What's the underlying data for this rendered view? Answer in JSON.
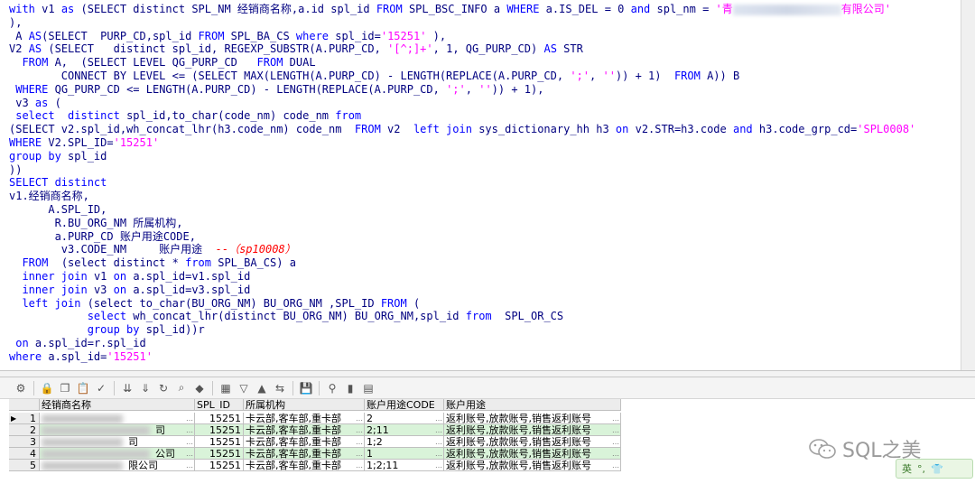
{
  "editor": {
    "lines": [
      [
        [
          "kw",
          "with "
        ],
        [
          "pl",
          "v1 "
        ],
        [
          "kw",
          "as "
        ],
        [
          "pl",
          "(SELECT distinct SPL_NM 经销商名称,a.id spl_id "
        ],
        [
          "kw",
          "FROM "
        ],
        [
          "pl",
          "SPL_BSC_INFO a "
        ],
        [
          "kw",
          "WHERE "
        ],
        [
          "pl",
          "a.IS_DEL = 0 "
        ],
        [
          "kw",
          "and "
        ],
        [
          "pl",
          "spl_nm = "
        ],
        [
          "str",
          "'青"
        ],
        [
          "blur",
          ""
        ],
        [
          "str",
          "有限公司'"
        ]
      ],
      [
        [
          "pl",
          "),"
        ]
      ],
      [
        [
          "pl",
          " A "
        ],
        [
          "kw",
          "AS"
        ],
        [
          "pl",
          "(SELECT  PURP_CD,spl_id "
        ],
        [
          "kw",
          "FROM "
        ],
        [
          "pl",
          "SPL_BA_CS "
        ],
        [
          "kw",
          "where "
        ],
        [
          "pl",
          "spl_id="
        ],
        [
          "str",
          "'15251'"
        ],
        [
          "pl",
          " ),"
        ]
      ],
      [
        [
          "pl",
          "V2 "
        ],
        [
          "kw",
          "AS "
        ],
        [
          "pl",
          "(SELECT   distinct spl_id, REGEXP_SUBSTR(A.PURP_CD, "
        ],
        [
          "str",
          "'[^;]+'"
        ],
        [
          "pl",
          ", 1, QG_PURP_CD) "
        ],
        [
          "kw",
          "AS "
        ],
        [
          "pl",
          "STR"
        ]
      ],
      [
        [
          "pl",
          "  "
        ],
        [
          "kw",
          "FROM "
        ],
        [
          "pl",
          "A,  (SELECT LEVEL QG_PURP_CD   "
        ],
        [
          "kw",
          "FROM "
        ],
        [
          "pl",
          "DUAL"
        ]
      ],
      [
        [
          "pl",
          "        CONNECT BY LEVEL <= (SELECT MAX(LENGTH(A.PURP_CD) - LENGTH(REPLACE(A.PURP_CD, "
        ],
        [
          "str",
          "';'"
        ],
        [
          "pl",
          ", "
        ],
        [
          "str",
          "''"
        ],
        [
          "pl",
          ")) + 1)  "
        ],
        [
          "kw",
          "FROM "
        ],
        [
          "pl",
          "A)) B"
        ]
      ],
      [
        [
          "pl",
          " "
        ],
        [
          "kw",
          "WHERE "
        ],
        [
          "pl",
          "QG_PURP_CD <= LENGTH(A.PURP_CD) - LENGTH(REPLACE(A.PURP_CD, "
        ],
        [
          "str",
          "';'"
        ],
        [
          "pl",
          ", "
        ],
        [
          "str",
          "''"
        ],
        [
          "pl",
          ")) + 1),"
        ]
      ],
      [
        [
          "pl",
          " v3 "
        ],
        [
          "kw",
          "as "
        ],
        [
          "pl",
          "("
        ]
      ],
      [
        [
          "pl",
          " "
        ],
        [
          "kw",
          "select  distinct "
        ],
        [
          "pl",
          "spl_id,to_char(code_nm) code_nm "
        ],
        [
          "kw",
          "from"
        ]
      ],
      [
        [
          "pl",
          "(SELECT v2.spl_id,wh_concat_lhr(h3.code_nm) code_nm  "
        ],
        [
          "kw",
          "FROM "
        ],
        [
          "pl",
          "v2  "
        ],
        [
          "kw",
          "left join "
        ],
        [
          "pl",
          "sys_dictionary_hh h3 "
        ],
        [
          "kw",
          "on "
        ],
        [
          "pl",
          "v2.STR=h3.code "
        ],
        [
          "kw",
          "and "
        ],
        [
          "pl",
          "h3.code_grp_cd="
        ],
        [
          "str",
          "'SPL0008'"
        ]
      ],
      [
        [
          "kw",
          "WHERE "
        ],
        [
          "pl",
          "V2.SPL_ID="
        ],
        [
          "str",
          "'15251'"
        ]
      ],
      [
        [
          "kw",
          "group by "
        ],
        [
          "pl",
          "spl_id"
        ]
      ],
      [
        [
          "pl",
          "))"
        ]
      ],
      [
        [
          "kw",
          "SELECT distinct"
        ]
      ],
      [
        [
          "pl",
          "v1.经销商名称,"
        ]
      ],
      [
        [
          "pl",
          "      A.SPL_ID,"
        ]
      ],
      [
        [
          "pl",
          "       R.BU_ORG_NM 所属机构,"
        ]
      ],
      [
        [
          "pl",
          "       a.PURP_CD 账户用途CODE,"
        ]
      ],
      [
        [
          "pl",
          "        v3.CODE_NM     账户用途  "
        ],
        [
          "cmt",
          "--（sp10008）"
        ]
      ],
      [
        [
          "pl",
          "  "
        ],
        [
          "kw",
          "FROM  "
        ],
        [
          "pl",
          "(select distinct * "
        ],
        [
          "kw",
          "from "
        ],
        [
          "pl",
          "SPL_BA_CS) a"
        ]
      ],
      [
        [
          "pl",
          "  "
        ],
        [
          "kw",
          "inner join "
        ],
        [
          "pl",
          "v1 "
        ],
        [
          "kw",
          "on "
        ],
        [
          "pl",
          "a.spl_id=v1.spl_id"
        ]
      ],
      [
        [
          "pl",
          "  "
        ],
        [
          "kw",
          "inner join "
        ],
        [
          "pl",
          "v3 "
        ],
        [
          "kw",
          "on "
        ],
        [
          "pl",
          "a.spl_id=v3.spl_id"
        ]
      ],
      [
        [
          "pl",
          "  "
        ],
        [
          "kw",
          "left join "
        ],
        [
          "pl",
          "(select to_char(BU_ORG_NM) BU_ORG_NM ,SPL_ID "
        ],
        [
          "kw",
          "FROM "
        ],
        [
          "pl",
          "("
        ]
      ],
      [
        [
          "pl",
          "            "
        ],
        [
          "kw",
          "select "
        ],
        [
          "pl",
          "wh_concat_lhr(distinct BU_ORG_NM) BU_ORG_NM,spl_id "
        ],
        [
          "kw",
          "from  "
        ],
        [
          "pl",
          "SPL_OR_CS"
        ]
      ],
      [
        [
          "pl",
          "            "
        ],
        [
          "kw",
          "group by "
        ],
        [
          "pl",
          "spl_id))r"
        ]
      ],
      [
        [
          "pl",
          " "
        ],
        [
          "kw",
          "on "
        ],
        [
          "pl",
          "a.spl_id=r.spl_id"
        ]
      ],
      [
        [
          "kw",
          "where "
        ],
        [
          "pl",
          "a.spl_id="
        ],
        [
          "str",
          "'15251'"
        ]
      ]
    ]
  },
  "toolbar": {
    "icons": [
      "grid-options-icon",
      "lock-icon",
      "copy-icon",
      "paste-icon",
      "check-icon",
      "move-down-icon",
      "move-last-icon",
      "refresh-icon",
      "find-icon",
      "clear-icon",
      "table-view-icon",
      "filter-icon",
      "sort-up-icon",
      "export-icon",
      "save-icon",
      "link-icon",
      "chart-icon",
      "table-icon"
    ]
  },
  "grid": {
    "headers": [
      "经销商名称",
      "SPL_ID",
      "所属机构",
      "账户用途CODE",
      "账户用途"
    ],
    "rows": [
      {
        "num": "1",
        "name_tail": "",
        "spl_id": "15251",
        "org": "卡云部,客车部,重卡部",
        "code": "2",
        "purpose": "返利账号,放款账号,销售返利账号"
      },
      {
        "num": "2",
        "name_tail": "司",
        "spl_id": "15251",
        "org": "卡云部,客车部,重卡部",
        "code": "2;11",
        "purpose": "返利账号,放款账号,销售返利账号"
      },
      {
        "num": "3",
        "name_tail": "司",
        "spl_id": "15251",
        "org": "卡云部,客车部,重卡部",
        "code": "1;2",
        "purpose": "返利账号,放款账号,销售返利账号"
      },
      {
        "num": "4",
        "name_tail": "公司",
        "spl_id": "15251",
        "org": "卡云部,客车部,重卡部",
        "code": "1",
        "purpose": "返利账号,放款账号,销售返利账号"
      },
      {
        "num": "5",
        "name_tail": "限公司",
        "spl_id": "15251",
        "org": "卡云部,客车部,重卡部",
        "code": "1;2;11",
        "purpose": "返利账号,放款账号,销售返利账号"
      }
    ]
  },
  "watermark": {
    "text": "SQL之美"
  },
  "ime": {
    "label": "英"
  }
}
